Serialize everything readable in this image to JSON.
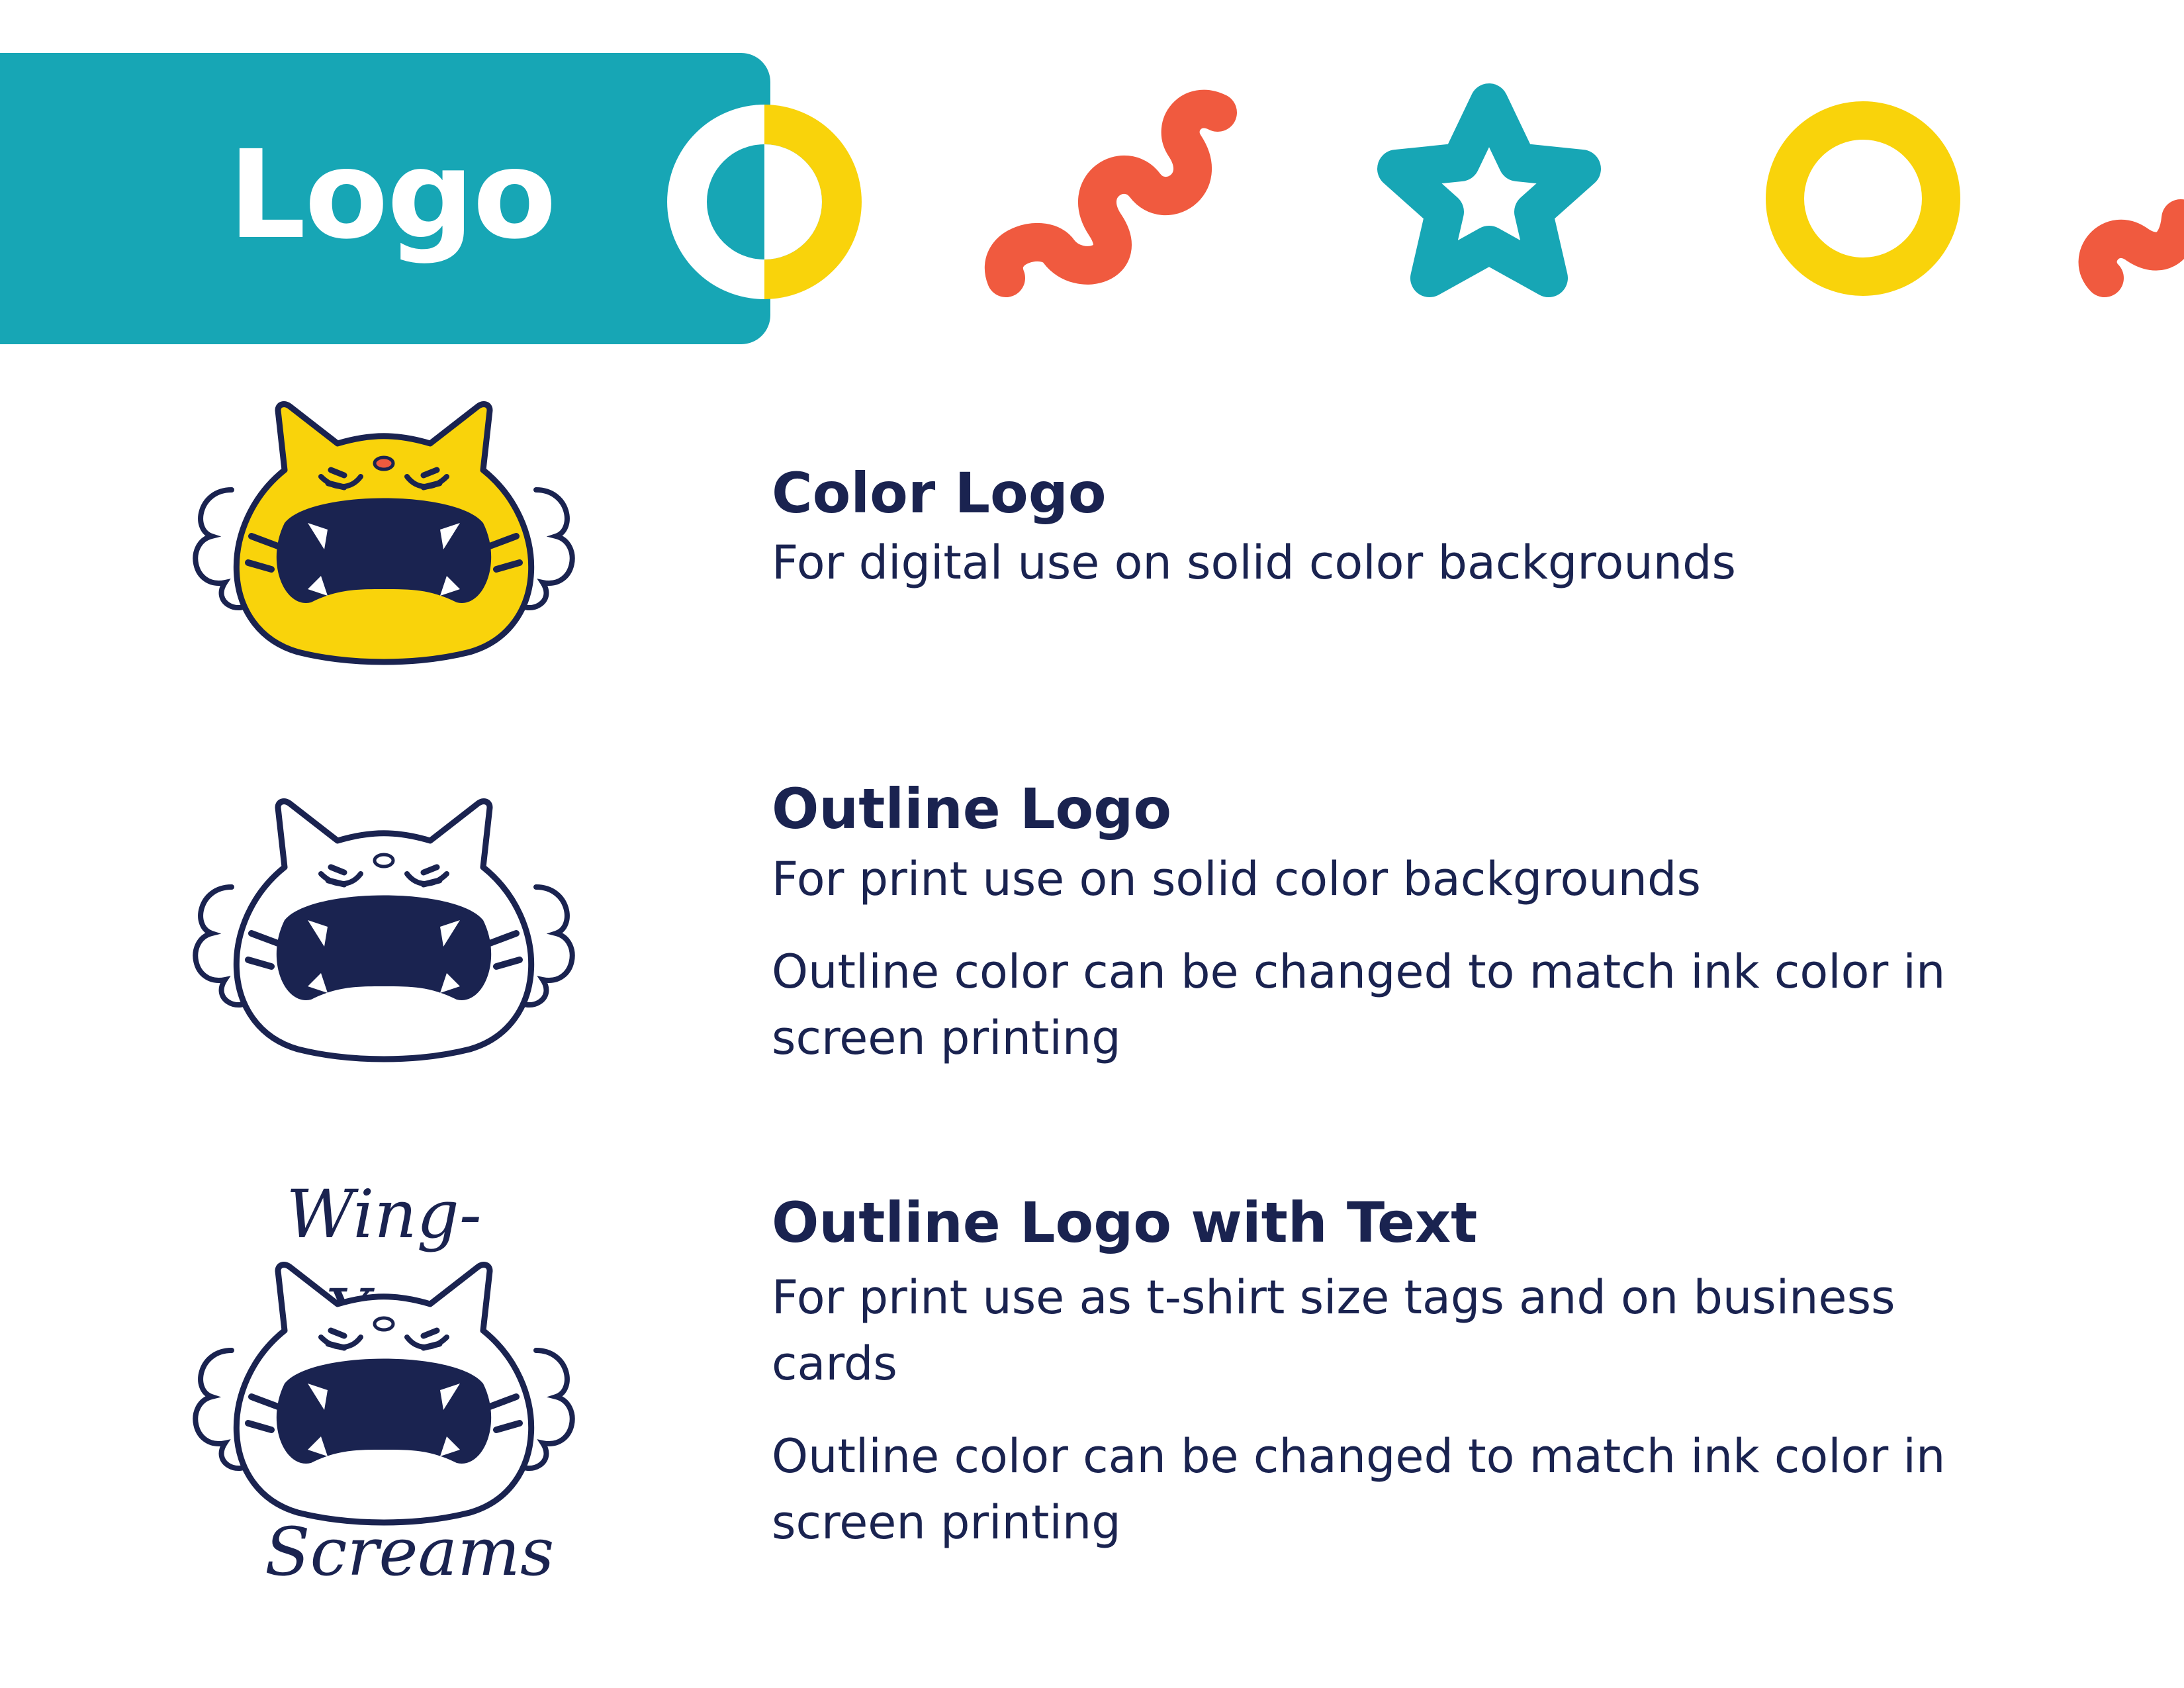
{
  "header": {
    "title": "Logo"
  },
  "decorations": [
    {
      "name": "half-circle-ring-icon",
      "colors": [
        "#ffffff",
        "#f9d30b"
      ]
    },
    {
      "name": "squiggle-icon",
      "color": "#f05a3f"
    },
    {
      "name": "star-outline-icon",
      "color": "#17a6b5"
    },
    {
      "name": "ring-icon",
      "color": "#f9d30b"
    },
    {
      "name": "squiggle-edge-icon",
      "color": "#f05a3f"
    }
  ],
  "sections": [
    {
      "title": "Color Logo",
      "description": "For digital use on solid color backgrounds",
      "logo_icon": "tiger-color-logo-icon"
    },
    {
      "title": "Outline Logo",
      "description": "For print use on solid color backgrounds",
      "note": "Outline color can be changed to match ink color in screen printing",
      "logo_icon": "tiger-outline-logo-icon"
    },
    {
      "title": "Outline Logo with Text",
      "description": "For print use as t-shirt size tags and on business cards",
      "note": "Outline color can be changed to match ink color in screen printing",
      "logo_icon": "tiger-outline-logo-with-text-icon",
      "logo_text_top": "Wing-Yee",
      "logo_text_bottom": "Screams"
    }
  ],
  "colors": {
    "teal": "#17a6b5",
    "yellow": "#f9d30b",
    "coral": "#f05a3f",
    "navy": "#1a2350",
    "white": "#ffffff"
  }
}
